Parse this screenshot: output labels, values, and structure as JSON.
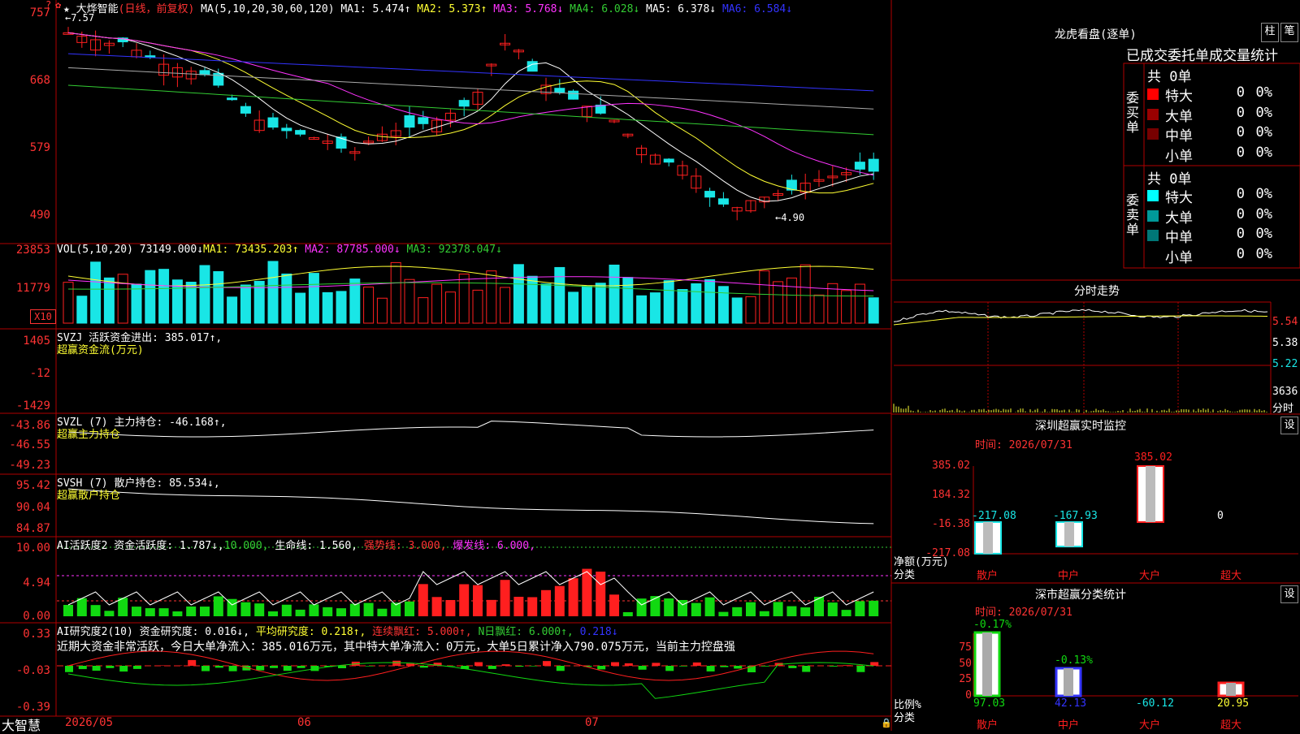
{
  "colors": {
    "up": "#ff1f1f",
    "down": "#19e6e6",
    "green": "#11d911",
    "border": "#b00000",
    "ma1": "#ffffff",
    "ma2": "#ffff33",
    "ma3": "#ff33ff",
    "ma4": "#33cc33",
    "ma5": "#aaaaaa",
    "ma6": "#3333ff"
  },
  "main": {
    "stock_name": "大烨智能",
    "period": "(日线，前复权)",
    "ma_title": "MA(5,10,20,30,60,120)",
    "ma_values": [
      {
        "label": "MA1: 5.474↑",
        "color": "#ffffff"
      },
      {
        "label": "MA2: 5.373↑",
        "color": "#ffff33"
      },
      {
        "label": "MA3: 5.768↓",
        "color": "#ff33ff"
      },
      {
        "label": "MA4: 6.028↓",
        "color": "#33cc33"
      },
      {
        "label": "MA5: 6.378↓",
        "color": "#ffffff"
      },
      {
        "label": "MA6: 6.584↓",
        "color": "#3333ff"
      }
    ],
    "y_ticks": [
      "757",
      "668",
      "579",
      "490"
    ],
    "high_label": "7.57",
    "low_label": "4.90"
  },
  "vol": {
    "title": "VOL(5,10,20)",
    "v": "73149.000↓",
    "ma1": "MA1: 73435.203↑",
    "ma2": "MA2: 87785.000↓",
    "ma3": "MA3: 92378.047↓",
    "y_ticks": [
      "23853",
      "11779"
    ],
    "unit": "X10"
  },
  "svzj": {
    "title": "SVZJ  活跃资金进出: 385.017↑,",
    "sub": "超赢资金流(万元)",
    "y_ticks": [
      "1405",
      "-12",
      "-1429"
    ]
  },
  "svzl": {
    "title": "SVZL (7) 主力持仓: -46.168↑,",
    "sub": "超赢主力持仓",
    "y_ticks": [
      "-43.86",
      "-46.55",
      "-49.23"
    ]
  },
  "svsh": {
    "title": "SVSH (7) 散户持仓: 85.534↓,",
    "sub": "超赢散户持仓",
    "y_ticks": [
      "95.42",
      "90.04",
      "84.87"
    ]
  },
  "ai1": {
    "title": "AI活跃度2 资金活跃度: 1.787↓,",
    "v2": "10.000,",
    "v3": "生命线: 1.560,",
    "v4": "强势线: 3.000,",
    "v5": "爆发线: 6.000,",
    "y_ticks": [
      "10.00",
      "4.94",
      "0.00"
    ]
  },
  "ai2": {
    "title": "AI研究度2(10) 资金研究度: 0.016↓,",
    "v2": "平均研究度: 0.218↑,",
    "v3": "连续飘红: 5.000↑,",
    "v4": "N日飘红: 6.000↑,",
    "v5": "0.218↓",
    "note": "近期大资金非常活跃，今日大单净流入：385.016万元，其中特大单净流入：0万元，大单5日累计净入790.075万元，当前主力控盘强",
    "y_ticks": [
      "0.33",
      "-0.03",
      "-0.39"
    ]
  },
  "footer": {
    "brand": "大智慧",
    "dates": [
      "2026/05",
      "06",
      "07"
    ]
  },
  "lhb": {
    "title": "龙虎看盘(逐单)",
    "btn1": "柱",
    "btn2": "笔",
    "sub": "已成交委托单成交量统计",
    "buy": {
      "side": "委买单",
      "total": "共 0单",
      "rows": [
        {
          "name": "特大",
          "v": "0",
          "p": "0%",
          "color": "#ff0000"
        },
        {
          "name": "大单",
          "v": "0",
          "p": "0%",
          "color": "#990000"
        },
        {
          "name": "中单",
          "v": "0",
          "p": "0%",
          "color": "#770000"
        },
        {
          "name": "小单",
          "v": "0",
          "p": "0%",
          "color": "#000000"
        }
      ]
    },
    "sell": {
      "side": "委卖单",
      "total": "共 0单",
      "rows": [
        {
          "name": "特大",
          "v": "0",
          "p": "0%",
          "color": "#00ffff"
        },
        {
          "name": "大单",
          "v": "0",
          "p": "0%",
          "color": "#009999"
        },
        {
          "name": "中单",
          "v": "0",
          "p": "0%",
          "color": "#007777"
        },
        {
          "name": "小单",
          "v": "0",
          "p": "0%",
          "color": "#000000"
        }
      ]
    }
  },
  "intraday": {
    "title": "分时走势",
    "y_ticks": [
      "5.54",
      "5.38",
      "5.22"
    ],
    "vol_top": "3636",
    "vol_label": "分时"
  },
  "sz_monitor": {
    "title": "深圳超赢实时监控",
    "btn": "设",
    "time": "时间: 2026/07/31",
    "y_ticks": [
      "385.02",
      "184.32",
      "-16.38",
      "-217.08"
    ],
    "bars": [
      {
        "cat": "散户",
        "val": "-217.08"
      },
      {
        "cat": "中户",
        "val": "-167.93"
      },
      {
        "cat": "大户",
        "val": "385.02"
      },
      {
        "cat": "超大",
        "val": "0"
      }
    ],
    "y_axis_label": "净额(万元)",
    "x_axis_label": "分类"
  },
  "sz_class": {
    "title": "深市超赢分类统计",
    "btn": "设",
    "time": "时间: 2026/07/31",
    "y_ticks": [
      "75",
      "50",
      "25",
      "0"
    ],
    "bars": [
      {
        "cat": "散户",
        "top": "-0.17%",
        "bottom": "97.03"
      },
      {
        "cat": "中户",
        "top": "-0.13%",
        "bottom": "42.13"
      },
      {
        "cat": "大户",
        "top": "",
        "bottom": "-60.12"
      },
      {
        "cat": "超大",
        "top": "",
        "bottom": "20.95"
      }
    ],
    "y_axis_label": "比例%",
    "x_axis_label": "分类"
  }
}
